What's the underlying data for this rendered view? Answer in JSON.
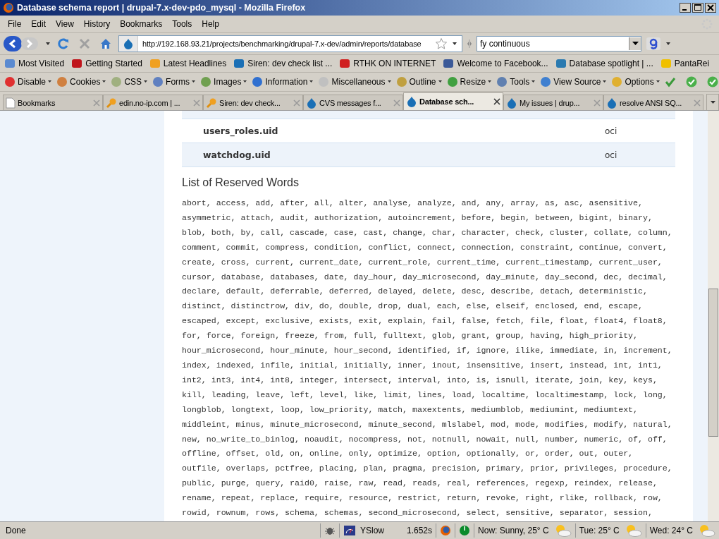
{
  "window": {
    "title": "Database schema report | drupal-7.x-dev-pdo_mysql - Mozilla Firefox"
  },
  "menu": [
    "File",
    "Edit",
    "View",
    "History",
    "Bookmarks",
    "Tools",
    "Help"
  ],
  "navbar": {
    "url": "http://192.168.93.21/projects/benchmarking/drupal-7.x-dev/admin/reports/database",
    "search": "fy continuous"
  },
  "bookmarks": [
    "Most Visited",
    "Getting Started",
    "Latest Headlines",
    "Siren: dev check list ...",
    "RTHK ON INTERNET",
    "Welcome to Facebook...",
    "Database spotlight | ...",
    "PantaRei"
  ],
  "webdev_toolbar": [
    "Disable",
    "Cookies",
    "CSS",
    "Forms",
    "Images",
    "Information",
    "Miscellaneous",
    "Outline",
    "Resize",
    "Tools",
    "View Source",
    "Options"
  ],
  "tabs": [
    {
      "label": "Bookmarks",
      "selected": false
    },
    {
      "label": "edin.no-ip.com | ...",
      "selected": false
    },
    {
      "label": "Siren: dev check...",
      "selected": false
    },
    {
      "label": "CVS messages f...",
      "selected": false
    },
    {
      "label": "Database sch...",
      "selected": true
    },
    {
      "label": "My issues | drup...",
      "selected": false
    },
    {
      "label": "resolve ANSI SQ...",
      "selected": false
    }
  ],
  "table": {
    "rows": [
      {
        "column_1": "users_roles.uid",
        "column_2": "oci"
      },
      {
        "column_1": "watchdog.uid",
        "column_2": "oci"
      }
    ]
  },
  "heading": "List of Reserved Words",
  "reserved_words_lines": [
    "abort, access, add, after, all, alter, analyse, analyze, and, any, array, as, asc, asensitive,",
    "asymmetric, attach, audit, authorization, autoincrement, before, begin, between, bigint, binary,",
    "blob, both, by, call, cascade, case, cast, change, char, character, check, cluster, collate, column,",
    "comment, commit, compress, condition, conflict, connect, connection, constraint, continue, convert,",
    "create, cross, current, current_date, current_role, current_time, current_timestamp, current_user,",
    "cursor, database, databases, date, day_hour, day_microsecond, day_minute, day_second, dec, decimal,",
    "declare, default, deferrable, deferred, delayed, delete, desc, describe, detach, deterministic,",
    "distinct, distinctrow, div, do, double, drop, dual, each, else, elseif, enclosed, end, escape,",
    "escaped, except, exclusive, exists, exit, explain, fail, false, fetch, file, float, float4, float8,",
    "for, force, foreign, freeze, from, full, fulltext, glob, grant, group, having, high_priority,",
    "hour_microsecond, hour_minute, hour_second, identified, if, ignore, ilike, immediate, in, increment,",
    "index, indexed, infile, initial, initially, inner, inout, insensitive, insert, instead, int, int1,",
    "int2, int3, int4, int8, integer, intersect, interval, into, is, isnull, iterate, join, key, keys,",
    "kill, leading, leave, left, level, like, limit, lines, load, localtime, localtimestamp, lock, long,",
    "longblob, longtext, loop, low_priority, match, maxextents, mediumblob, mediumint, mediumtext,",
    "middleint, minus, minute_microsecond, minute_second, mlslabel, mod, mode, modifies, modify, natural,",
    "new, no_write_to_binlog, noaudit, nocompress, not, notnull, nowait, null, number, numeric, of, off,",
    "offline, offset, old, on, online, only, optimize, option, optionally, or, order, out, outer,",
    "outfile, overlaps, pctfree, placing, plan, pragma, precision, primary, prior, privileges, procedure,",
    "public, purge, query, raid0, raise, raw, read, reads, real, references, regexp, reindex, release,",
    "rename, repeat, replace, require, resource, restrict, return, revoke, right, rlike, rollback, row,",
    "rowid, rownum, rows, schema, schemas, second_microsecond, select, sensitive, separator, session,"
  ],
  "status_bar": {
    "status": "Done",
    "yslow": "YSlow",
    "load_time": "1.652s",
    "weather": [
      "Now: Sunny, 25° C",
      "Tue: 25° C",
      "Wed: 24° C"
    ]
  }
}
